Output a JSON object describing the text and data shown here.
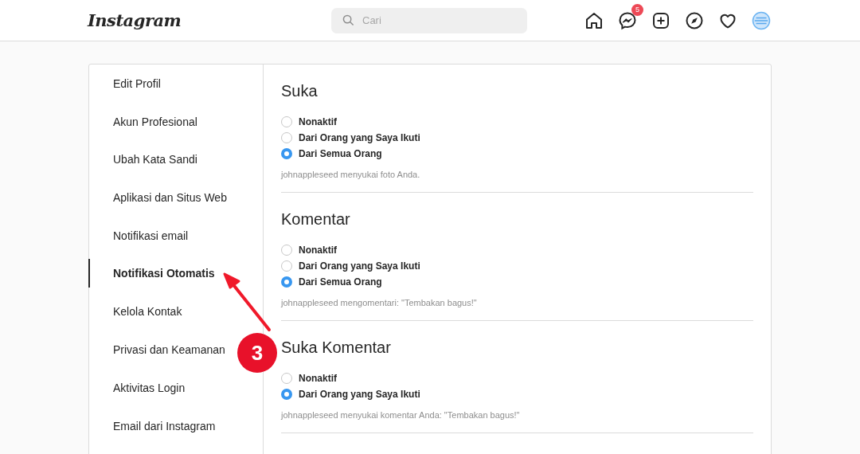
{
  "header": {
    "logo": "Instagram",
    "search": {
      "placeholder": "Cari"
    },
    "messages_badge": "5"
  },
  "sidebar": {
    "items": [
      {
        "label": "Edit Profil",
        "selected": false
      },
      {
        "label": "Akun Profesional",
        "selected": false
      },
      {
        "label": "Ubah Kata Sandi",
        "selected": false
      },
      {
        "label": "Aplikasi dan Situs Web",
        "selected": false
      },
      {
        "label": "Notifikasi email",
        "selected": false
      },
      {
        "label": "Notifikasi Otomatis",
        "selected": true
      },
      {
        "label": "Kelola Kontak",
        "selected": false
      },
      {
        "label": "Privasi dan Keamanan",
        "selected": false
      },
      {
        "label": "Aktivitas Login",
        "selected": false
      },
      {
        "label": "Email dari Instagram",
        "selected": false
      }
    ]
  },
  "sections": [
    {
      "title": "Suka",
      "options": [
        {
          "label": "Nonaktif",
          "selected": false
        },
        {
          "label": "Dari Orang yang Saya Ikuti",
          "selected": false
        },
        {
          "label": "Dari Semua Orang",
          "selected": true
        }
      ],
      "example": "johnappleseed menyukai foto Anda."
    },
    {
      "title": "Komentar",
      "options": [
        {
          "label": "Nonaktif",
          "selected": false
        },
        {
          "label": "Dari Orang yang Saya Ikuti",
          "selected": false
        },
        {
          "label": "Dari Semua Orang",
          "selected": true
        }
      ],
      "example": "johnappleseed mengomentari: \"Tembakan bagus!\""
    },
    {
      "title": "Suka Komentar",
      "options": [
        {
          "label": "Nonaktif",
          "selected": false
        },
        {
          "label": "Dari Orang yang Saya Ikuti",
          "selected": true
        }
      ],
      "example": "johnappleseed menyukai komentar Anda: \"Tembakan bagus!\""
    }
  ],
  "annotation": {
    "number": "3"
  }
}
